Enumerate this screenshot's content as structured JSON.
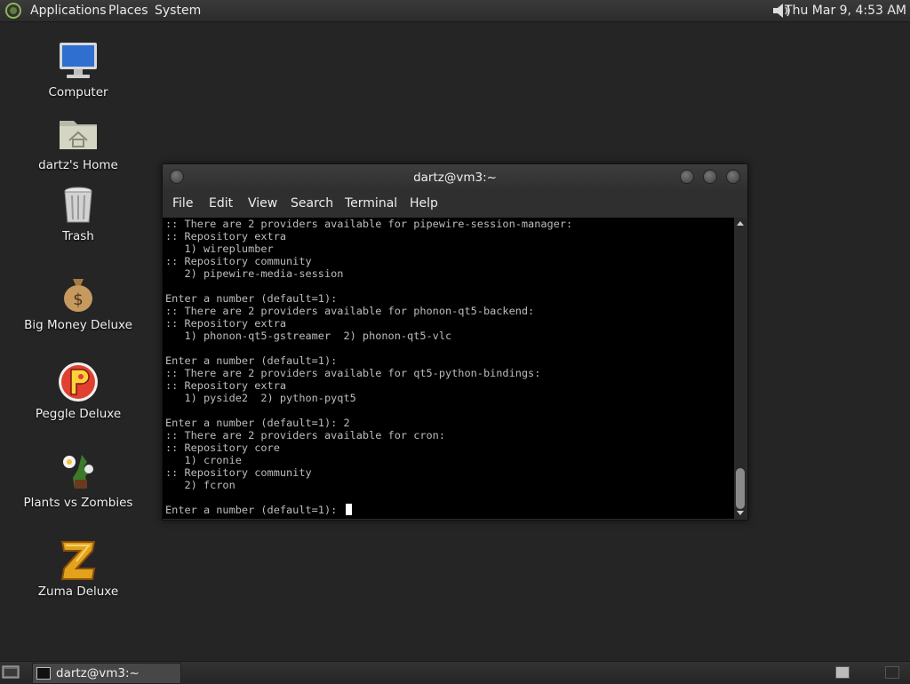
{
  "top_panel": {
    "menus": [
      "Applications",
      "Places",
      "System"
    ],
    "clock": "Thu Mar  9,  4:53 AM",
    "icons": {
      "logo": "mate-logo-icon",
      "volume": "volume-icon"
    }
  },
  "desktop": {
    "icons": [
      {
        "label": "Computer",
        "icon": "computer-monitor-icon"
      },
      {
        "label": "dartz's Home",
        "icon": "home-folder-icon"
      },
      {
        "label": "Trash",
        "icon": "trash-can-icon"
      },
      {
        "label": "Big Money Deluxe",
        "icon": "money-bag-icon"
      },
      {
        "label": "Peggle Deluxe",
        "icon": "peggle-icon"
      },
      {
        "label": "Plants vs Zombies",
        "icon": "plants-vs-zombies-icon"
      },
      {
        "label": "Zuma Deluxe",
        "icon": "zuma-icon"
      }
    ]
  },
  "terminal": {
    "title": "dartz@vm3:~",
    "menu": [
      "File",
      "Edit",
      "View",
      "Search",
      "Terminal",
      "Help"
    ],
    "lines": [
      ":: There are 2 providers available for pipewire-session-manager:",
      ":: Repository extra",
      "   1) wireplumber",
      ":: Repository community",
      "   2) pipewire-media-session",
      "",
      "Enter a number (default=1):",
      ":: There are 2 providers available for phonon-qt5-backend:",
      ":: Repository extra",
      "   1) phonon-qt5-gstreamer  2) phonon-qt5-vlc",
      "",
      "Enter a number (default=1):",
      ":: There are 2 providers available for qt5-python-bindings:",
      ":: Repository extra",
      "   1) pyside2  2) python-pyqt5",
      "",
      "Enter a number (default=1): 2",
      ":: There are 2 providers available for cron:",
      ":: Repository core",
      "   1) cronie",
      ":: Repository community",
      "   2) fcron",
      "",
      "Enter a number (default=1): "
    ]
  },
  "taskbar": {
    "window_label": "dartz@vm3:~",
    "icons": {
      "show_desktop": "show-desktop-icon",
      "window": "terminal-icon"
    }
  },
  "colors": {
    "desktop_bg": "#252525",
    "terminal_bg": "#000000",
    "terminal_fg": "#bdbdbd"
  }
}
